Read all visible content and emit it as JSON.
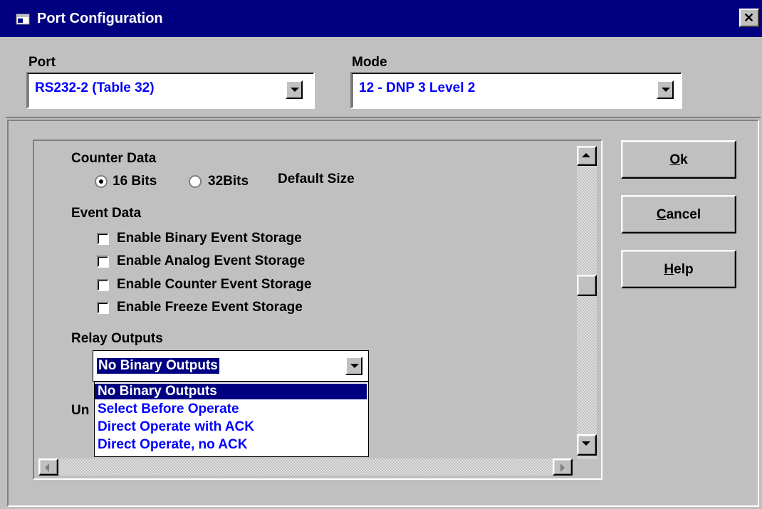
{
  "window": {
    "title": "Port Configuration",
    "icon": "app-window-icon",
    "close_glyph": "✕"
  },
  "port": {
    "label": "Port",
    "value": "RS232-2 (Table 32)"
  },
  "mode": {
    "label": "Mode",
    "value": "12 - DNP 3 Level 2"
  },
  "counter_data": {
    "heading": "Counter Data",
    "options": [
      {
        "label": "16 Bits",
        "selected": true
      },
      {
        "label": "32Bits",
        "selected": false
      }
    ],
    "suffix": "Default Size"
  },
  "event_data": {
    "heading": "Event Data",
    "items": [
      {
        "label": "Enable Binary Event Storage",
        "checked": false
      },
      {
        "label": "Enable Analog Event Storage",
        "checked": false
      },
      {
        "label": "Enable Counter Event Storage",
        "checked": false
      },
      {
        "label": "Enable Freeze Event Storage",
        "checked": false
      }
    ]
  },
  "relay_outputs": {
    "heading": "Relay Outputs",
    "value": "No Binary Outputs",
    "options": [
      "No Binary Outputs",
      "Select Before Operate",
      "Direct Operate with ACK",
      "Direct Operate, no ACK"
    ],
    "selected_index": 0
  },
  "obscured_label": "Un",
  "buttons": {
    "ok": {
      "mnemonic": "O",
      "rest": "k"
    },
    "cancel": {
      "mnemonic": "C",
      "rest": "ancel"
    },
    "help": {
      "mnemonic": "H",
      "rest": "elp"
    }
  },
  "colors": {
    "title_bar": "#000080",
    "face": "#c0c0c0",
    "value_text": "#0000ff",
    "highlight": "#000080"
  }
}
